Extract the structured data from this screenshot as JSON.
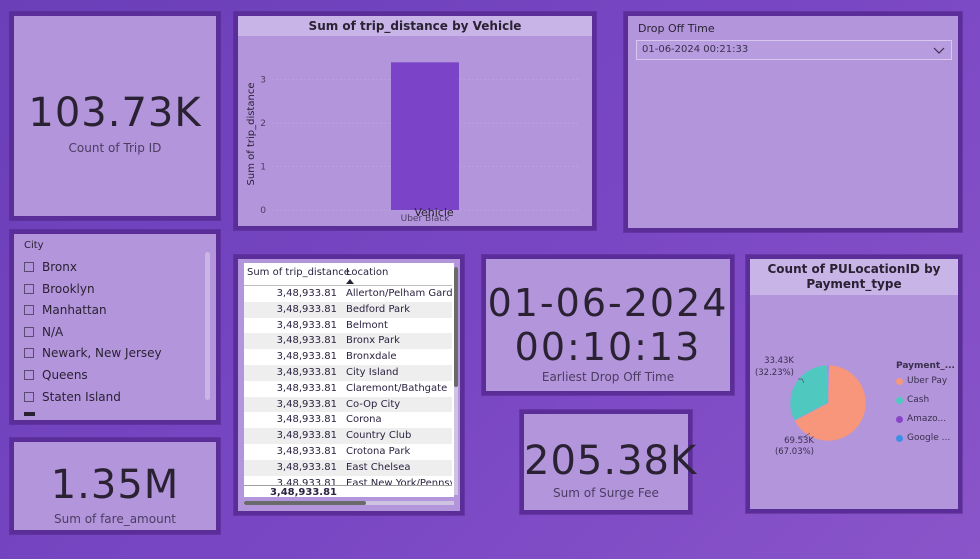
{
  "kpi_trip": {
    "value": "103.73K",
    "label": "Count of Trip ID"
  },
  "bar_chart": {
    "title": "Sum of trip_distance by Vehicle"
  },
  "chart_data": {
    "type": "bar",
    "title": "Sum of trip_distance by Vehicle",
    "categories": [
      "Uber Black"
    ],
    "values": [
      3.4
    ],
    "xlabel": "Vehicle",
    "ylabel": "Sum of trip_distance",
    "ylim": [
      0,
      3.5
    ],
    "yticks": [
      "3",
      "2",
      "1",
      "0"
    ],
    "colors": [
      "#7a43c8"
    ]
  },
  "dropoff": {
    "title": "Drop Off Time",
    "selected": "01-06-2024 00:21:33"
  },
  "city": {
    "title": "City",
    "items": [
      "Bronx",
      "Brooklyn",
      "Manhattan",
      "N/A",
      "Newark, New Jersey",
      "Queens",
      "Staten Island"
    ]
  },
  "table": {
    "headers": [
      "Sum of trip_distance",
      "Location"
    ],
    "rows": [
      [
        "3,48,933.81",
        "Allerton/Pelham Gardens"
      ],
      [
        "3,48,933.81",
        "Bedford Park"
      ],
      [
        "3,48,933.81",
        "Belmont"
      ],
      [
        "3,48,933.81",
        "Bronx Park"
      ],
      [
        "3,48,933.81",
        "Bronxdale"
      ],
      [
        "3,48,933.81",
        "City Island"
      ],
      [
        "3,48,933.81",
        "Claremont/Bathgate"
      ],
      [
        "3,48,933.81",
        "Co-Op City"
      ],
      [
        "3,48,933.81",
        "Corona"
      ],
      [
        "3,48,933.81",
        "Country Club"
      ],
      [
        "3,48,933.81",
        "Crotona Park"
      ],
      [
        "3,48,933.81",
        "East Chelsea"
      ],
      [
        "3,48,933.81",
        "East New York/Pennsylvania"
      ]
    ],
    "total": "3,48,933.81"
  },
  "earliest": {
    "date": "01-06-2024",
    "time": "00:10:13",
    "label": "Earliest Drop Off Time"
  },
  "fare": {
    "value": "1.35M",
    "label": "Sum of fare_amount"
  },
  "surge": {
    "value": "205.38K",
    "label": "Sum of Surge Fee"
  },
  "pie": {
    "title_line1": "Count of PULocationID by",
    "title_line2": "Payment_type",
    "legend_title": "Payment_...",
    "legend": [
      {
        "label": "Uber Pay",
        "color": "#f7967a"
      },
      {
        "label": "Cash",
        "color": "#4fc9c0"
      },
      {
        "label": "Amazo...",
        "color": "#8a44c8"
      },
      {
        "label": "Google ...",
        "color": "#3d8fe6"
      }
    ],
    "label_top_value": "33.43K",
    "label_top_pct": "(32.23%)",
    "label_bottom_value": "69.53K",
    "label_bottom_pct": "(67.03%)",
    "slices": [
      {
        "label": "Uber Pay",
        "value": 69.53,
        "color": "#f7967a"
      },
      {
        "label": "Cash",
        "value": 33.43,
        "color": "#4fc9c0"
      },
      {
        "label": "Amazo...",
        "value": 0.4,
        "color": "#8a44c8"
      },
      {
        "label": "Google ...",
        "value": 0.37,
        "color": "#3d8fe6"
      }
    ]
  }
}
